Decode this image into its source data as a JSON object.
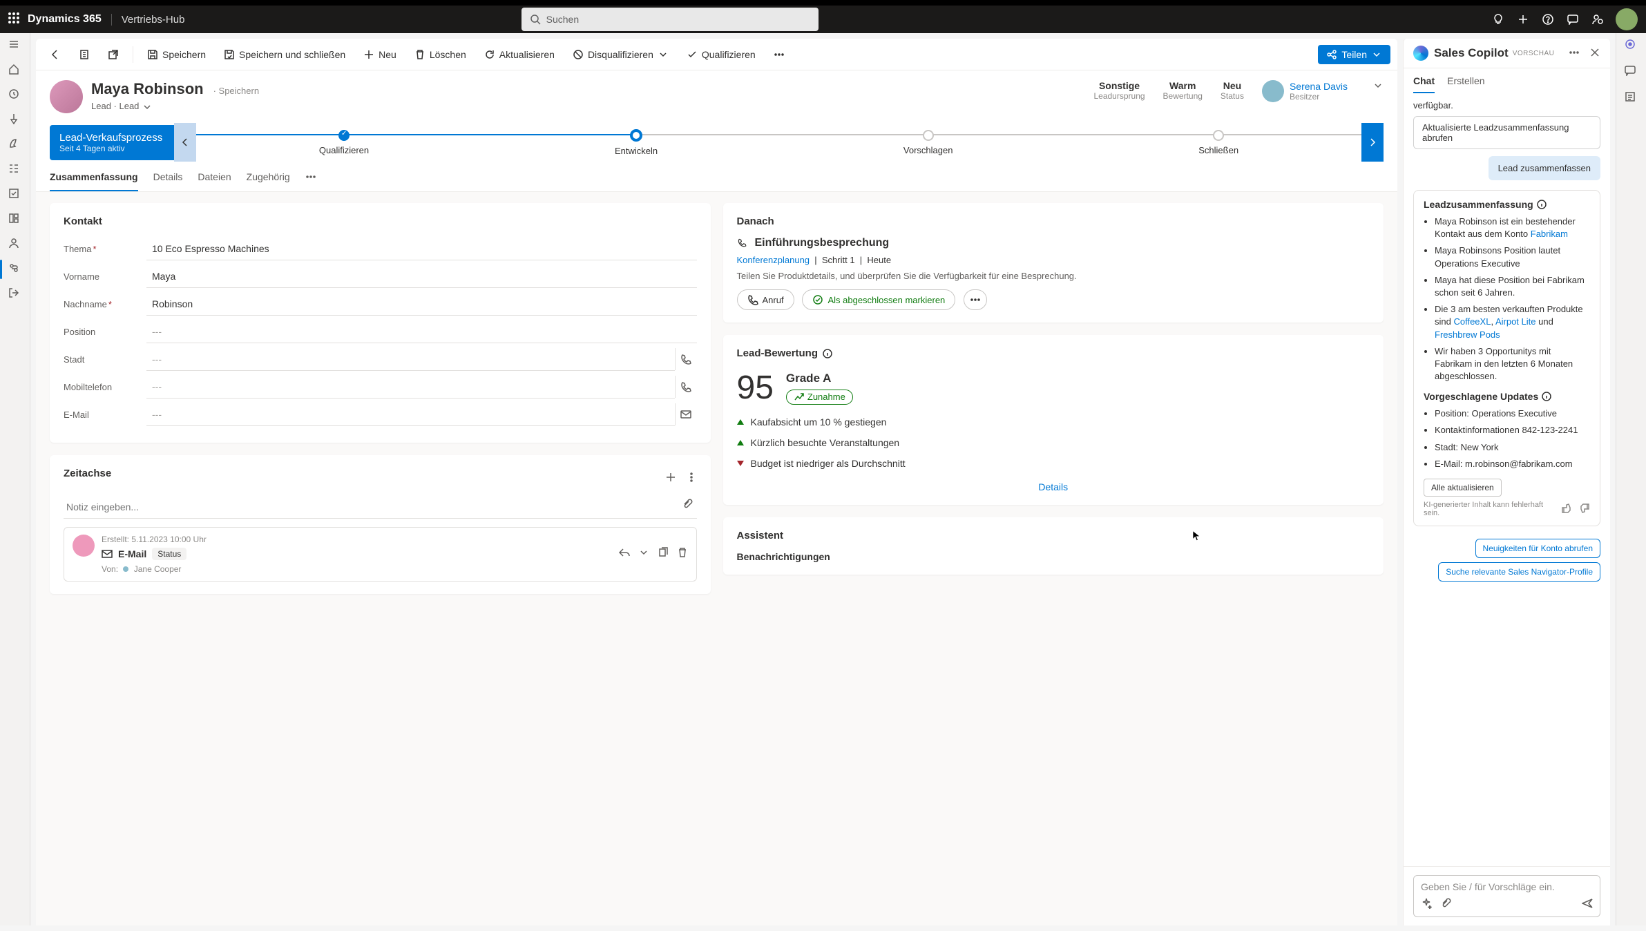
{
  "topbar": {
    "brand": "Dynamics 365",
    "hub": "Vertriebs-Hub",
    "search_placeholder": "Suchen"
  },
  "cmdbar": {
    "save": "Speichern",
    "saveClose": "Speichern und schließen",
    "new": "Neu",
    "delete": "Löschen",
    "refresh": "Aktualisieren",
    "disqualify": "Disqualifizieren",
    "qualify": "Qualifizieren",
    "share": "Teilen"
  },
  "record": {
    "name": "Maya Robinson",
    "saving": "Speichern",
    "entity": "Lead",
    "formSel": "Lead",
    "kpis": {
      "source": {
        "v": "Sonstige",
        "l": "Leadursprung"
      },
      "rating": {
        "v": "Warm",
        "l": "Bewertung"
      },
      "status": {
        "v": "Neu",
        "l": "Status"
      }
    },
    "owner": {
      "name": "Serena Davis",
      "role": "Besitzer"
    }
  },
  "bpf": {
    "name": "Lead-Verkaufsprozess",
    "since": "Seit 4 Tagen aktiv",
    "stages": [
      "Qualifizieren",
      "Entwickeln",
      "Vorschlagen",
      "Schließen"
    ],
    "activeLinePct": 38
  },
  "tabs": [
    "Zusammenfassung",
    "Details",
    "Dateien",
    "Zugehörig"
  ],
  "contact": {
    "title": "Kontakt",
    "topic": {
      "label": "Thema",
      "value": "10 Eco Espresso Machines"
    },
    "first": {
      "label": "Vorname",
      "value": "Maya"
    },
    "last": {
      "label": "Nachname",
      "value": "Robinson"
    },
    "position": {
      "label": "Position",
      "value": "---"
    },
    "city": {
      "label": "Stadt",
      "value": "---"
    },
    "mobile": {
      "label": "Mobiltelefon",
      "value": "---"
    },
    "email": {
      "label": "E-Mail",
      "value": "---"
    }
  },
  "timeline": {
    "title": "Zeitachse",
    "placeholder": "Notiz eingeben...",
    "item": {
      "created": "Erstellt: 5.11.2023 10:00 Uhr",
      "type": "E-Mail",
      "status": "Status",
      "fromLabel": "Von:",
      "from": "Jane Cooper"
    }
  },
  "next": {
    "section": "Danach",
    "title": "Einführungsbesprechung",
    "link": "Konferenzplanung",
    "step": "Schritt 1",
    "when": "Heute",
    "desc": "Teilen Sie Produktdetails, und überprüfen Sie die Verfügbarkeit für eine Besprechung.",
    "call": "Anruf",
    "complete": "Als abgeschlossen markieren"
  },
  "score": {
    "section": "Lead-Bewertung",
    "value": "95",
    "grade": "Grade A",
    "trend": "Zunahme",
    "factors": {
      "f1": "Kaufabsicht um 10 % gestiegen",
      "f2": "Kürzlich besuchte Veranstaltungen",
      "f3": "Budget ist niedriger als Durchschnitt"
    },
    "details": "Details"
  },
  "assistant": {
    "title": "Assistent",
    "sub": "Benachrichtigungen"
  },
  "copilot": {
    "title": "Sales Copilot",
    "preview": "VORSCHAU",
    "tabs": {
      "chat": "Chat",
      "create": "Erstellen"
    },
    "truncated": "verfügbar.",
    "chip": "Aktualisierte Leadzusammenfassung abrufen",
    "userMsg": "Lead zusammenfassen",
    "summaryTitle": "Leadzusammenfassung",
    "summary": {
      "b1a": "Maya Robinson ist ein bestehender Kontakt aus dem Konto ",
      "b1link": "Fabrikam",
      "b2": "Maya Robinsons Position lautet Operations Executive",
      "b3": "Maya hat diese Position bei Fabrikam schon seit 6 Jahren.",
      "b4a": "Die 3 am besten verkauften Produkte sind ",
      "b4l1": "CoffeeXL",
      "b4s1": ", ",
      "b4l2": "Airpot Lite",
      "b4s2": " und ",
      "b4l3": "Freshbrew Pods",
      "b5": "Wir haben 3 Opportunitys mit Fabrikam in den letzten 6 Monaten abgeschlossen."
    },
    "updatesTitle": "Vorgeschlagene Updates",
    "updates": {
      "u1": "Position: Operations Executive",
      "u2": "Kontaktinformationen 842-123-2241",
      "u3": "Stadt: New York",
      "u4": "E-Mail: m.robinson@fabrikam.com"
    },
    "updateAll": "Alle aktualisieren",
    "disclaimer": "KI-generierter Inhalt kann fehlerhaft sein.",
    "sugg1": "Neuigkeiten für Konto abrufen",
    "sugg2": "Suche relevante Sales Navigator-Profile",
    "input_placeholder": "Geben Sie / für Vorschläge ein."
  }
}
